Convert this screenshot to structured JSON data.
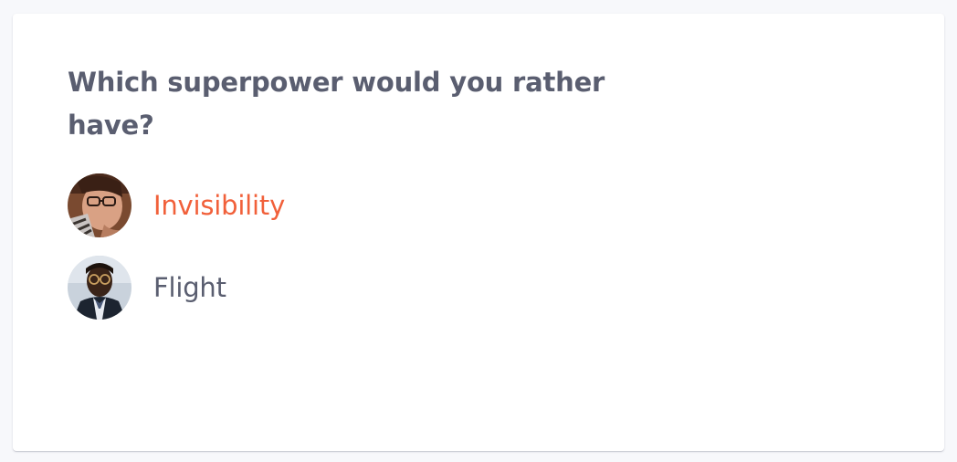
{
  "poll": {
    "question": "Which superpower would you rather have?",
    "options": [
      {
        "label": "Invisibility",
        "selected": true,
        "avatar": "user-avatar-woman-glasses"
      },
      {
        "label": "Flight",
        "selected": false,
        "avatar": "user-avatar-man-glasses"
      }
    ]
  },
  "colors": {
    "background": "#f7f8fb",
    "card": "#ffffff",
    "text": "#5a5e70",
    "selected": "#f1603a"
  }
}
